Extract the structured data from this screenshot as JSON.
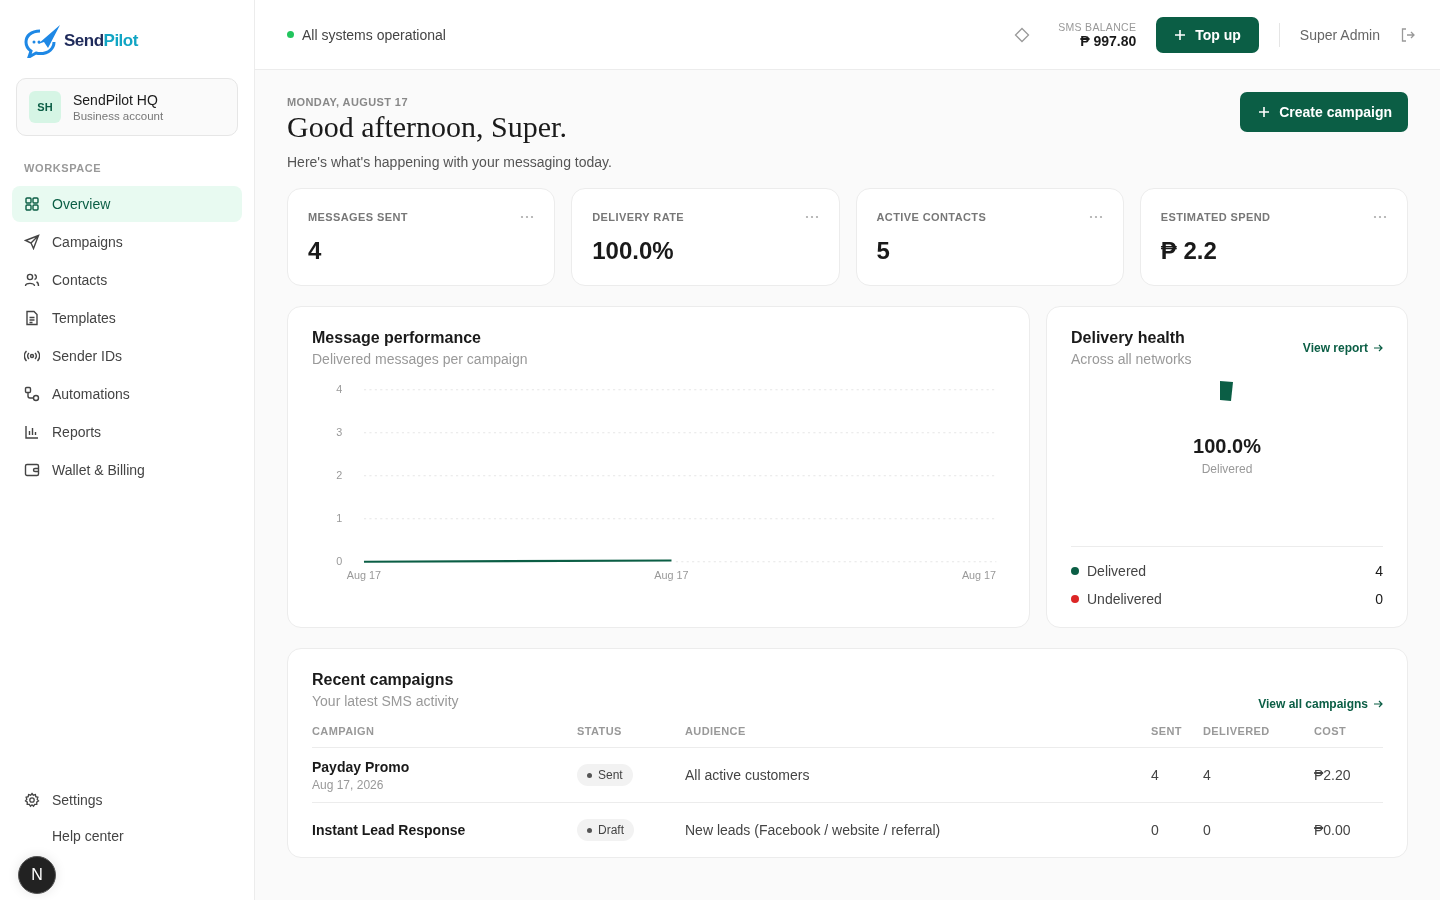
{
  "brand": {
    "wordmark": [
      "Send",
      "Pilot"
    ]
  },
  "account": {
    "initials": "SH",
    "name": "SendPilot HQ",
    "type": "Business account"
  },
  "sidebar": {
    "section": "WORKSPACE",
    "items": [
      {
        "label": "Overview",
        "selected": true
      },
      {
        "label": "Campaigns",
        "selected": false
      },
      {
        "label": "Contacts",
        "selected": false
      },
      {
        "label": "Templates",
        "selected": false
      },
      {
        "label": "Sender IDs",
        "selected": false
      },
      {
        "label": "Automations",
        "selected": false
      },
      {
        "label": "Reports",
        "selected": false
      },
      {
        "label": "Wallet & Billing",
        "selected": false
      }
    ],
    "footer": [
      {
        "label": "Settings"
      },
      {
        "label": "Help center"
      }
    ]
  },
  "dev_badge": {
    "label": "N"
  },
  "topbar": {
    "status": "All systems operational",
    "balance_label": "SMS BALANCE",
    "balance": "₱ 997.80",
    "topup": "Top up",
    "user": "Super Admin"
  },
  "header": {
    "date": "MONDAY, AUGUST 17",
    "greeting": "Good afternoon, Super.",
    "subtitle": "Here's what's happening with your messaging today.",
    "action": "Create campaign"
  },
  "stats": [
    {
      "label": "MESSAGES SENT",
      "value": "4"
    },
    {
      "label": "DELIVERY RATE",
      "value": "100.0%"
    },
    {
      "label": "ACTIVE CONTACTS",
      "value": "5"
    },
    {
      "label": "ESTIMATED SPEND",
      "value": "₱ 2.2"
    }
  ],
  "performance": {
    "title": "Message performance",
    "subtitle": "Delivered messages per campaign",
    "chart_data": {
      "type": "line",
      "x": [
        "Aug 17",
        "Aug 17",
        "Aug 17"
      ],
      "ylim": [
        0,
        4
      ],
      "yticks": [
        0,
        1,
        2,
        3,
        4
      ],
      "grid": true,
      "series": [
        {
          "color": "#0b5e45",
          "values": [
            0,
            0.03,
            null
          ]
        }
      ]
    }
  },
  "health": {
    "title": "Delivery health",
    "subtitle": "Across all networks",
    "link": "View report",
    "value": "100.0%",
    "value_label": "Delivered",
    "legend": [
      {
        "label": "Delivered",
        "value": "4",
        "color": "#0b5e45"
      },
      {
        "label": "Undelivered",
        "value": "0",
        "color": "#dc2626"
      }
    ]
  },
  "recent": {
    "title": "Recent campaigns",
    "subtitle": "Your latest SMS activity",
    "link": "View all campaigns",
    "columns": [
      "CAMPAIGN",
      "STATUS",
      "AUDIENCE",
      "SENT",
      "DELIVERED",
      "COST"
    ],
    "rows": [
      {
        "name": "Payday Promo",
        "date": "Aug 17, 2026",
        "status": "Sent",
        "audience": "All active customers",
        "sent": "4",
        "delivered": "4",
        "cost": "₱2.20"
      },
      {
        "name": "Instant Lead Response",
        "status": "Draft",
        "audience": "New leads (Facebook / website / referral)",
        "sent": "0",
        "delivered": "0",
        "cost": "₱0.00"
      }
    ]
  }
}
